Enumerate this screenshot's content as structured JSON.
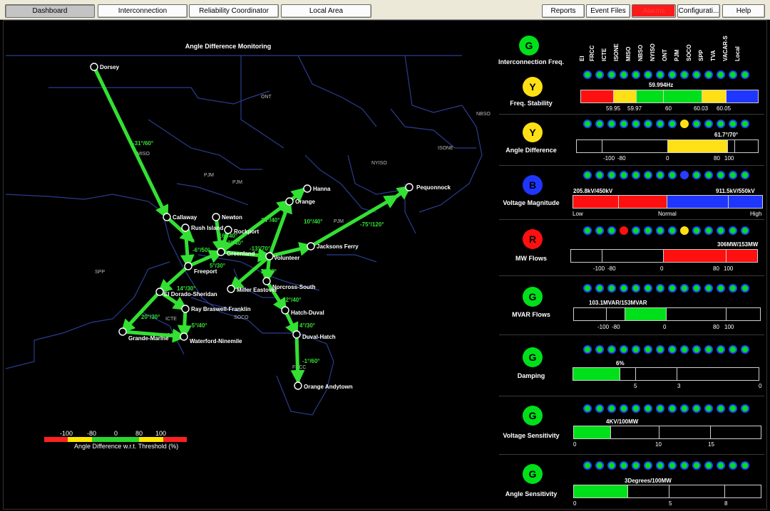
{
  "nav": {
    "dashboard": "Dashboard",
    "interconnection": "Interconnection",
    "reliability": "Reliability Coordinator",
    "local": "Local Area",
    "reports": "Reports",
    "event_files": "Event Files",
    "alarms": "Alarms",
    "configuration": "Configurati...",
    "help": "Help"
  },
  "map": {
    "title": "Angle Difference Monitoring",
    "regions": [
      "ONT",
      "MISO",
      "PJM",
      "PJM",
      "NYISO",
      "ISONE",
      "NBSO",
      "PJM",
      "SPP",
      "ICTE",
      "SOCO",
      "FRCC"
    ],
    "nodes": [
      "Dorsey",
      "Callaway",
      "Rush Island",
      "Newton",
      "Rockport",
      "Hanna",
      "Orange",
      "Pequonnock",
      "Jacksons Ferry",
      "Freeport",
      "El Dorado-Sheridan",
      "Ray Braswell-Franklin",
      "Miller Eastover",
      "Norcross-South",
      "Hatch-Duval",
      "Duval-Hatch",
      "Orange Andytown",
      "Waterford-Ninemile",
      "Grande-Marine",
      "Volunteer",
      "Greenland"
    ],
    "edge_labels": [
      "-31°/60°",
      "24°/40°",
      "10°/40°",
      "-75°/120°",
      "-16°/40°",
      "-12°/40°",
      "-6°/50°",
      "-13°/70°",
      "5°/30°",
      "2°/40°",
      "14°/30°",
      "12°/40°",
      "20°/30°",
      "-5°/40°",
      "-6°/30°",
      "4°/30°",
      "-1°/60°"
    ]
  },
  "legend": {
    "ticks": [
      "-100",
      "-80",
      "0",
      "80",
      "100"
    ],
    "colors": [
      "#ff2020",
      "#ffe600",
      "#2bd62b",
      "#2bd62b",
      "#ffe600",
      "#ff2020"
    ],
    "caption": "Angle Difference w.r.t. Threshold (%)"
  },
  "dashboard": {
    "columns": [
      "EI",
      "FRCC",
      "ICTE",
      "ISONE",
      "MISO",
      "NBSO",
      "NYISO",
      "ONT",
      "PJM",
      "SOCO",
      "SPP",
      "TVA",
      "VACAR-S",
      "Local"
    ],
    "interconnection": {
      "status": "G",
      "label": "Interconnection Freq."
    },
    "freq_stability": {
      "status": "Y",
      "label": "Freq. Stability",
      "value": "59.994Hz",
      "ticks": [
        "59.95",
        "59.97",
        "60",
        "60.03",
        "60.05"
      ],
      "dots": [
        "green",
        "green",
        "green",
        "green",
        "green",
        "green",
        "green",
        "green",
        "green",
        "green",
        "green",
        "green",
        "green",
        "green"
      ]
    },
    "angle_difference": {
      "status": "Y",
      "label": "Angle Difference",
      "value": "61.7°/70°",
      "ticks": [
        "-100",
        "-80",
        "0",
        "80",
        "100"
      ],
      "fill_percent": 82,
      "dots": [
        "green",
        "green",
        "green",
        "green",
        "green",
        "green",
        "green",
        "green",
        "yellow",
        "green",
        "green",
        "green",
        "green",
        "green"
      ]
    },
    "voltage_magnitude": {
      "status": "B",
      "label": "Voltage Magnitude",
      "value_left": "205.8kV/450kV",
      "value_right": "911.5kV/550kV",
      "ticks": [
        "Low",
        "Normal",
        "High"
      ],
      "dots": [
        "green",
        "green",
        "green",
        "green",
        "green",
        "green",
        "green",
        "green",
        "blue",
        "green",
        "green",
        "green",
        "green",
        "green"
      ]
    },
    "mw_flows": {
      "status": "R",
      "label": "MW Flows",
      "value": "306MW/153MW",
      "ticks": [
        "-100",
        "-80",
        "0",
        "80",
        "100"
      ],
      "fill_percent": 200,
      "dots": [
        "green",
        "green",
        "green",
        "red",
        "green",
        "green",
        "green",
        "green",
        "yellow",
        "green",
        "green",
        "green",
        "green",
        "green"
      ]
    },
    "mvar_flows": {
      "status": "G",
      "label": "MVAR Flows",
      "value": "103.1MVAR/153MVAR",
      "ticks": [
        "-100",
        "-80",
        "0",
        "80",
        "100"
      ],
      "fill_percent": 67,
      "dots": [
        "green",
        "green",
        "green",
        "green",
        "green",
        "green",
        "green",
        "green",
        "green",
        "green",
        "green",
        "green",
        "green",
        "green"
      ]
    },
    "damping": {
      "status": "G",
      "label": "Damping",
      "value": "6%",
      "ticks": [
        "5",
        "3",
        "0"
      ],
      "dots": [
        "green",
        "green",
        "green",
        "green",
        "green",
        "green",
        "green",
        "green",
        "green",
        "green",
        "green",
        "green",
        "green",
        "green"
      ]
    },
    "voltage_sensitivity": {
      "status": "G",
      "label": "Voltage Sensitivity",
      "value": "4KV/100MW",
      "ticks": [
        "0",
        "10",
        "15"
      ],
      "dots": [
        "green",
        "green",
        "green",
        "green",
        "green",
        "green",
        "green",
        "green",
        "green",
        "green",
        "green",
        "green",
        "green",
        "green"
      ]
    },
    "angle_sensitivity": {
      "status": "G",
      "label": "Angle Sensitivity",
      "value": "3Degrees/100MW",
      "ticks": [
        "0",
        "5",
        "8"
      ],
      "dots": [
        "green",
        "green",
        "green",
        "green",
        "green",
        "green",
        "green",
        "green",
        "green",
        "green",
        "green",
        "green",
        "green",
        "green"
      ]
    }
  },
  "colors": {
    "green": "#00e01a",
    "yellow": "#ffe016",
    "red": "#ff1010",
    "blue": "#1f36ff",
    "dot_border": "#2049ff"
  }
}
